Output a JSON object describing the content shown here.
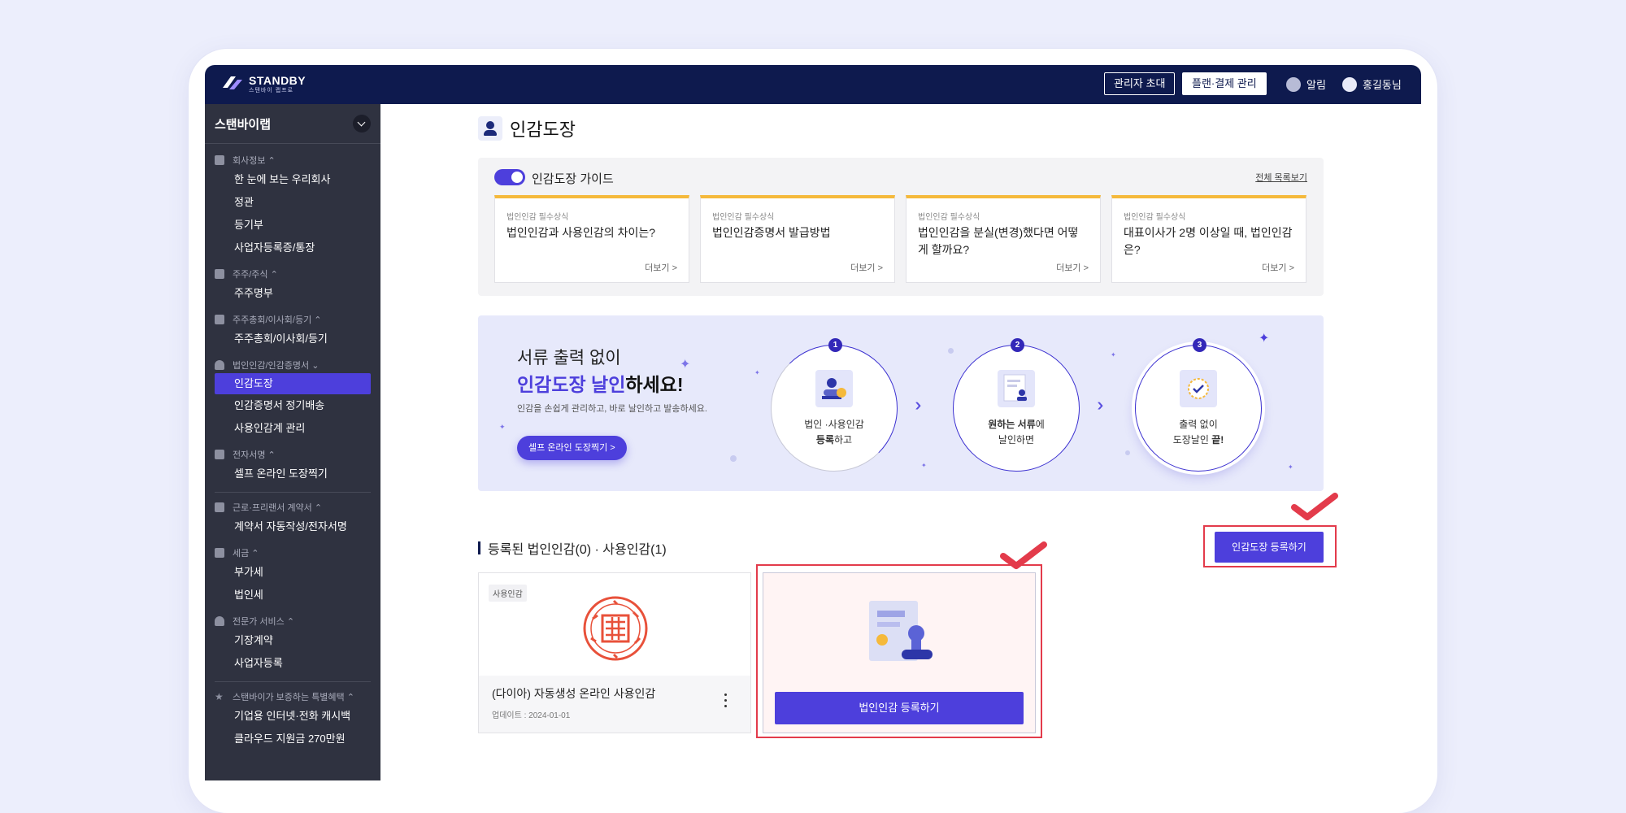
{
  "header": {
    "logo_text": "STANDBY",
    "logo_subtext": "스탠바이 랩프로",
    "invite_admin_label": "관리자 초대",
    "plan_billing_label": "플랜·결제 관리",
    "notification_label": "알림",
    "user_label": "홍길동님"
  },
  "sidebar": {
    "company_name": "스탠바이랩",
    "sections": [
      {
        "title": "회사정보",
        "items": [
          "한 눈에 보는 우리회사",
          "정관",
          "등기부",
          "사업자등록증/통장"
        ]
      },
      {
        "title": "주주/주식",
        "items": [
          "주주명부"
        ]
      },
      {
        "title": "주주총회/이사회/등기",
        "items": [
          "주주총회/이사회/등기"
        ]
      },
      {
        "title": "법인인감/인감증명서",
        "items": [
          "인감도장",
          "인감증명서 정기배송",
          "사용인감계 관리"
        ]
      },
      {
        "title": "전자서명",
        "items": [
          "셀프 온라인 도장찍기"
        ]
      },
      {
        "title": "근로·프리랜서 계약서",
        "items": [
          "계약서 자동작성/전자서명"
        ]
      },
      {
        "title": "세금",
        "items": [
          "부가세",
          "법인세"
        ]
      },
      {
        "title": "전문가 서비스",
        "items": [
          "기장계약",
          "사업자등록"
        ]
      },
      {
        "title": "스탠바이가 보증하는 특별혜택",
        "items": [
          "기업용 인터넷·전화 캐시백",
          "클라우드 지원금 270만원"
        ]
      }
    ]
  },
  "page": {
    "title": "인감도장"
  },
  "guide": {
    "title": "인감도장 가이드",
    "view_all": "전체 목록보기",
    "cards": [
      {
        "tag": "법인인감 필수상식",
        "question": "법인인감과 사용인감의 차이는?",
        "more": "더보기 >"
      },
      {
        "tag": "법인인감 필수상식",
        "question": "법인인감증명서 발급방법",
        "more": "더보기 >"
      },
      {
        "tag": "법인인감 필수상식",
        "question": "법인인감을 분실(변경)했다면 어떻게 할까요?",
        "more": "더보기 >"
      },
      {
        "tag": "법인인감 필수상식",
        "question": "대표이사가 2명 이상일 때, 법인인감은?",
        "more": "더보기 >"
      }
    ]
  },
  "banner": {
    "line1": "서류 출력 없이",
    "line2_highlight": "인감도장 날인",
    "line2_rest": "하세요!",
    "description": "인감을 손쉽게 관리하고, 바로 날인하고 발송하세요.",
    "button_label": "셀프 온라인 도장찍기 >",
    "steps": [
      {
        "num": "1",
        "line1": "법인 ·사용인감",
        "line2_bold": "등록",
        "line2_rest": "하고"
      },
      {
        "num": "2",
        "line1_bold": "원하는 서류",
        "line1_rest": "에",
        "line2": "날인하면"
      },
      {
        "num": "3",
        "line1": "출력 없이",
        "line2_rest": "도장날인 ",
        "line2_bold": "끝!"
      }
    ]
  },
  "registered": {
    "section_title": "등록된 법인인감(0) · 사용인감(1)",
    "register_button": "인감도장 등록하기",
    "seal_card": {
      "badge": "사용인감",
      "name": "(다이아) 자동생성 온라인 사용인감",
      "updated": "업데이트 : 2024-01-01"
    },
    "corporate_card": {
      "button": "법인인감 등록하기"
    }
  },
  "colors": {
    "accent": "#4d3fdc",
    "header_bg": "#0e1a4e",
    "sidebar_bg": "#2f3240",
    "highlight_red": "#e33b4b",
    "guide_card_top": "#f5b93b",
    "seal_red": "#e8513a"
  }
}
